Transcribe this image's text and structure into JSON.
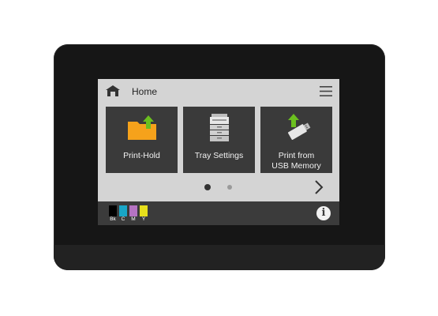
{
  "header": {
    "title": "Home"
  },
  "tiles": [
    {
      "label_line1": "Print-Hold",
      "label_line2": ""
    },
    {
      "label_line1": "Tray Settings",
      "label_line2": ""
    },
    {
      "label_line1": "Print from",
      "label_line2": "USB Memory"
    }
  ],
  "pagination": {
    "current_page": 1,
    "total_pages": 2
  },
  "ink_levels": [
    {
      "label": "Bk",
      "color": "#000000"
    },
    {
      "label": "C",
      "color": "#19a6c7"
    },
    {
      "label": "M",
      "color": "#b573c2"
    },
    {
      "label": "Y",
      "color": "#e7df1c"
    }
  ],
  "colors": {
    "folder": "#f6a21b",
    "upload_arrow": "#6bbf1f",
    "dot_active": "#333333",
    "dot_inactive": "#9a9a9a"
  },
  "icons": {
    "home": "home-icon",
    "menu": "hamburger-menu-icon",
    "next": "chevron-right-icon",
    "info": "info-icon"
  }
}
